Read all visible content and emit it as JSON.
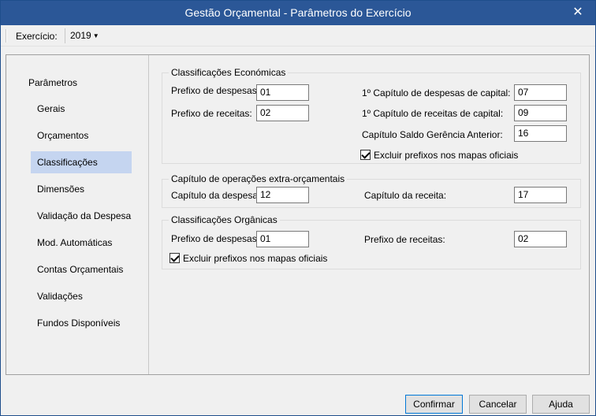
{
  "window": {
    "title": "Gestão Orçamental - Parâmetros do Exercício",
    "close_glyph": "✕"
  },
  "toolbar": {
    "exercicio_label": "Exercício:",
    "exercicio_value": "2019"
  },
  "nav": {
    "root": "Parâmetros",
    "items": [
      {
        "label": "Gerais"
      },
      {
        "label": "Orçamentos"
      },
      {
        "label": "Classificações",
        "selected": true
      },
      {
        "label": "Dimensões"
      },
      {
        "label": "Validação da Despesa"
      },
      {
        "label": "Mod. Automáticas"
      },
      {
        "label": "Contas Orçamentais"
      },
      {
        "label": "Validações"
      },
      {
        "label": "Fundos Disponíveis"
      }
    ]
  },
  "economicas": {
    "title": "Classificações Económicas",
    "prefixo_despesas_label": "Prefixo de despesas:",
    "prefixo_despesas_value": "01",
    "prefixo_receitas_label": "Prefixo de receitas:",
    "prefixo_receitas_value": "02",
    "cap_despesas_capital_label": "1º Capítulo de despesas de capital:",
    "cap_despesas_capital_value": "07",
    "cap_receitas_capital_label": "1º Capítulo de receitas de capital:",
    "cap_receitas_capital_value": "09",
    "cap_saldo_label": "Capítulo Saldo Gerência Anterior:",
    "cap_saldo_value": "16",
    "excluir_label": "Excluir prefixos nos mapas oficiais",
    "excluir_checked": true
  },
  "extra": {
    "title": "Capítulo de operações extra-orçamentais",
    "cap_despesa_label": "Capítulo da despesa:",
    "cap_despesa_value": "12",
    "cap_receita_label": "Capítulo da receita:",
    "cap_receita_value": "17"
  },
  "organicas": {
    "title": "Classificações Orgânicas",
    "prefixo_despesas_label": "Prefixo de despesas:",
    "prefixo_despesas_value": "01",
    "prefixo_receitas_label": "Prefixo de receitas:",
    "prefixo_receitas_value": "02",
    "excluir_label": "Excluir prefixos nos mapas oficiais",
    "excluir_checked": true
  },
  "footer": {
    "confirmar": "Confirmar",
    "cancelar": "Cancelar",
    "ajuda": "Ajuda"
  }
}
